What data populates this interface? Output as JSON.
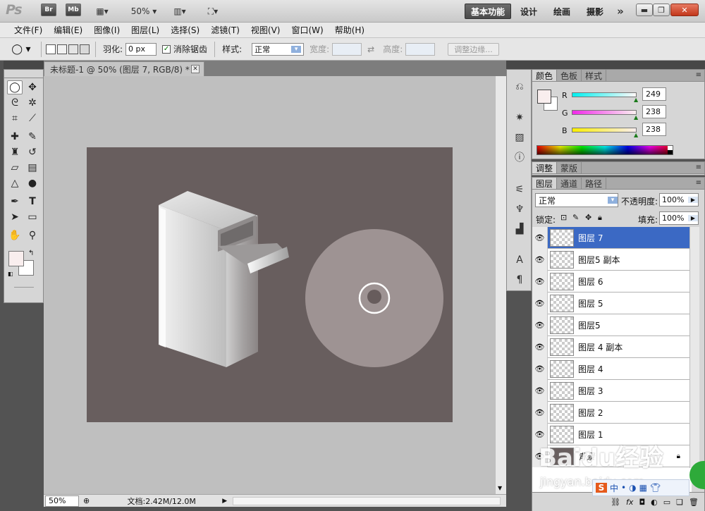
{
  "titlebar": {
    "app_logo": "Ps",
    "bridge": "Br",
    "minibridge": "Mb",
    "zoom": "50%",
    "workspaces": [
      "基本功能",
      "设计",
      "绘画",
      "摄影"
    ],
    "more": "»",
    "window": {
      "minimize": "▬",
      "restore": "❐",
      "close": "✕"
    }
  },
  "menu": [
    "文件(F)",
    "编辑(E)",
    "图像(I)",
    "图层(L)",
    "选择(S)",
    "滤镜(T)",
    "视图(V)",
    "窗口(W)",
    "帮助(H)"
  ],
  "options": {
    "feather_label": "羽化:",
    "feather_value": "0 px",
    "antialias_label": "消除锯齿",
    "antialias_checked": true,
    "style_label": "样式:",
    "style_value": "正常",
    "width_label": "宽度:",
    "height_label": "高度:",
    "refine_label": "调整边缘..."
  },
  "document": {
    "tab_title": "未标题-1 @ 50% (图层 7, RGB/8) *",
    "close": "✕",
    "canvas_color": "#685e5e"
  },
  "status": {
    "zoom": "50%",
    "doc_info": "文档:2.42M/12.0M"
  },
  "color_panel": {
    "tabs": [
      "颜色",
      "色板",
      "样式"
    ],
    "channels": [
      {
        "label": "R",
        "value": "249",
        "gradient": "linear-gradient(90deg,#00f0f0,#fff8f8)"
      },
      {
        "label": "G",
        "value": "238",
        "gradient": "linear-gradient(90deg,#f028e8,#faf0f0)"
      },
      {
        "label": "B",
        "value": "238",
        "gradient": "linear-gradient(90deg,#f9ee00,#f9eef0)"
      }
    ],
    "foreground": "#f9eeee",
    "background": "#ffffff"
  },
  "adjust_panel": {
    "tabs": [
      "调整",
      "蒙版"
    ]
  },
  "layers_panel": {
    "tabs": [
      "图层",
      "通道",
      "路径"
    ],
    "blend_mode": "正常",
    "opacity_label": "不透明度:",
    "opacity": "100%",
    "lock_label": "锁定:",
    "fill_label": "填充:",
    "fill": "100%",
    "layers": [
      {
        "name": "图层 7",
        "selected": true
      },
      {
        "name": "图层5 副本",
        "selected": false
      },
      {
        "name": "图层 6",
        "selected": false
      },
      {
        "name": "图层 5",
        "selected": false
      },
      {
        "name": "图层5",
        "selected": false
      },
      {
        "name": "图层 4 副本",
        "selected": false
      },
      {
        "name": "图层 4",
        "selected": false
      },
      {
        "name": "图层 3",
        "selected": false
      },
      {
        "name": "图层 2",
        "selected": false
      },
      {
        "name": "图层 1",
        "selected": false
      },
      {
        "name": "背景",
        "selected": false
      }
    ]
  },
  "watermark": {
    "brand": "Baidu经验",
    "url": "jingyan.baidu.com"
  }
}
